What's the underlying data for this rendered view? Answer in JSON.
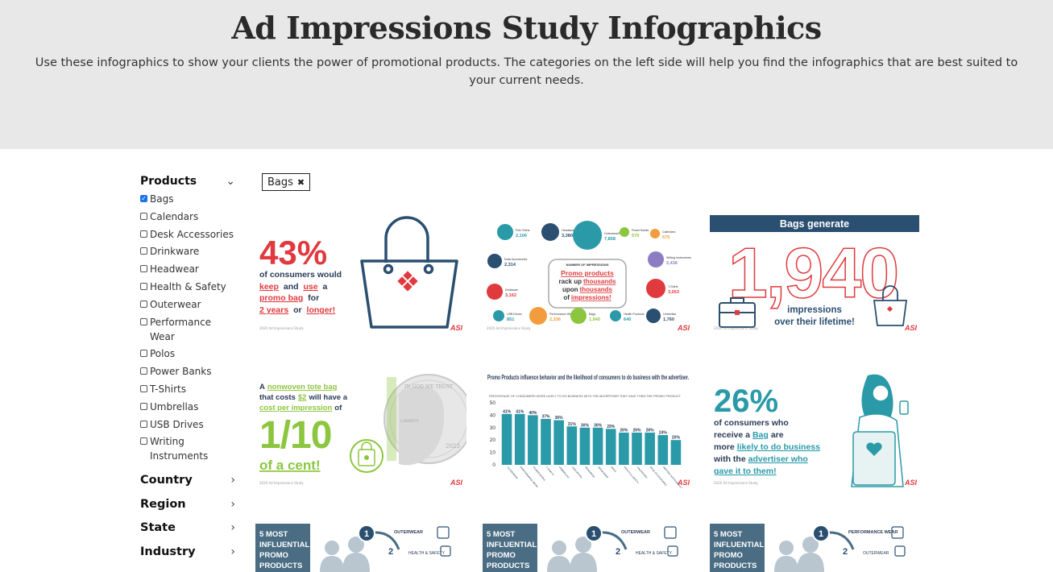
{
  "header": {
    "title": "Ad Impressions Study Infographics",
    "description": "Use these infographics to show your clients the power of promotional products. The categories on the left side will help you find the infographics that are best suited to your current needs."
  },
  "sidebar": {
    "products": {
      "title": "Products",
      "items": [
        {
          "label": "Bags",
          "checked": true
        },
        {
          "label": "Calendars",
          "checked": false
        },
        {
          "label": "Desk Accessories",
          "checked": false
        },
        {
          "label": "Drinkware",
          "checked": false
        },
        {
          "label": "Headwear",
          "checked": false
        },
        {
          "label": "Health & Safety",
          "checked": false
        },
        {
          "label": "Outerwear",
          "checked": false
        },
        {
          "label": "Performance Wear",
          "checked": false
        },
        {
          "label": "Polos",
          "checked": false
        },
        {
          "label": "Power Banks",
          "checked": false
        },
        {
          "label": "T-Shirts",
          "checked": false
        },
        {
          "label": "Umbrellas",
          "checked": false
        },
        {
          "label": "USB Drives",
          "checked": false
        },
        {
          "label": "Writing Instruments",
          "checked": false
        }
      ]
    },
    "collapsed": [
      "Country",
      "Region",
      "State",
      "Industry"
    ]
  },
  "active_filter": {
    "label": "Bags"
  },
  "cards": {
    "c1": {
      "big": "43%",
      "l1": "of consumers would",
      "l2a": "keep",
      "l2b": "and",
      "l2c": "use",
      "l2d": "a",
      "l3a": "promo bag",
      "l3b": "for",
      "l4a": "2 years",
      "l4b": "or",
      "l4c": "longer!",
      "foot": "2020 Ad Impressions Study",
      "brand": "ASI"
    },
    "c2": {
      "items": [
        {
          "name": "Polo Shirts",
          "value": "2,106"
        },
        {
          "name": "Headwear",
          "value": "3,380"
        },
        {
          "name": "Outerwear/Fleece",
          "value": "7,858"
        },
        {
          "name": "Power Banks",
          "value": "570"
        },
        {
          "name": "Calendars",
          "value": "675"
        },
        {
          "name": "Desk Accessories",
          "value": "2,314"
        },
        {
          "name": "Writing Instruments",
          "value": "2,436"
        },
        {
          "name": "Drinkware",
          "value": "3,162"
        },
        {
          "name": "T-Shirts",
          "value": "3,053"
        },
        {
          "name": "USB Drives",
          "value": "851"
        },
        {
          "name": "Performance Wear",
          "value": "2,336"
        },
        {
          "name": "Bags",
          "value": "1,940"
        },
        {
          "name": "Health Products",
          "value": "640"
        },
        {
          "name": "Umbrellas",
          "value": "1,760"
        }
      ],
      "center_head": "NUMBER OF IMPRESSIONS",
      "center1": "Promo products",
      "center2a": "rack up",
      "center2b": "thousands",
      "center3a": "upon",
      "center3b": "thousands",
      "center4a": "of",
      "center4b": "impressions!",
      "foot": "2020 Ad Impressions Study",
      "brand": "ASI"
    },
    "c3": {
      "banner": "Bags generate",
      "big": "1,940",
      "sub1": "impressions",
      "sub2": "over their lifetime!",
      "foot": "2020 Ad Impressions Study",
      "brand": "ASI"
    },
    "c4": {
      "l1a": "A",
      "l1b": "nonwoven tote bag",
      "l2": "that costs",
      "l2b": "$2",
      "l2c": "will have a",
      "l3": "cost per impression",
      "l3b": "of",
      "big": "1/10",
      "sub": "of a cent!",
      "coin_top": "IN GOD WE TRUST",
      "coin_liberty": "LIBERTY",
      "coin_year": "2023",
      "foot": "2020 Ad Impressions Study",
      "brand": "ASI"
    },
    "c6": {
      "big": "26%",
      "l1": "of consumers who",
      "l2a": "receive a",
      "l2b": "Bag",
      "l2c": "are",
      "l3a": "more",
      "l3b": "likely to do business",
      "l4a": "with the",
      "l4b": "advertiser who",
      "l5": "gave it to them!",
      "foot": "2020 Ad Impressions Study",
      "brand": "ASI"
    },
    "row3": [
      {
        "banner": "5 MOST INFLUENTIAL PROMO PRODUCTS",
        "first": "OUTERWEAR",
        "second": "HEALTH & SAFETY"
      },
      {
        "banner": "5 MOST INFLUENTIAL PROMO PRODUCTS",
        "first": "OUTERWEAR",
        "second": "HEALTH & SAFETY"
      },
      {
        "banner": "5 MOST INFLUENTIAL PROMO PRODUCTS",
        "first": "PERFORMANCE WEAR",
        "second": "OUTERWEAR"
      }
    ]
  },
  "chart_data": {
    "type": "bar",
    "title": "Promo Products influence behavior and the likelihood of consumers to do business with the advertiser.",
    "subtitle": "PERCENTAGE OF CONSUMERS MORE LIKELY TO DO BUSINESS WITH THE ADVERTISER THAT GAVE THEM THE PROMO PRODUCT",
    "categories": [
      "Outerwear",
      "Performance Wear",
      "Power Banks",
      "T-Shirts",
      "Umbrellas",
      "USB Drives",
      "Headwear",
      "Drinkware",
      "Bags",
      "Health & Safety",
      "Calendars",
      "Desk Accessories",
      "Writing Instruments"
    ],
    "values": [
      41,
      41,
      40,
      37,
      36,
      31,
      30,
      30,
      29,
      26,
      26,
      26,
      24,
      20
    ],
    "ylim": [
      0,
      50
    ],
    "yticks": [
      0,
      10,
      20,
      30,
      40,
      50
    ],
    "colors": {
      "bar": "#2a9aa8",
      "accent": "#e03a3e"
    }
  }
}
